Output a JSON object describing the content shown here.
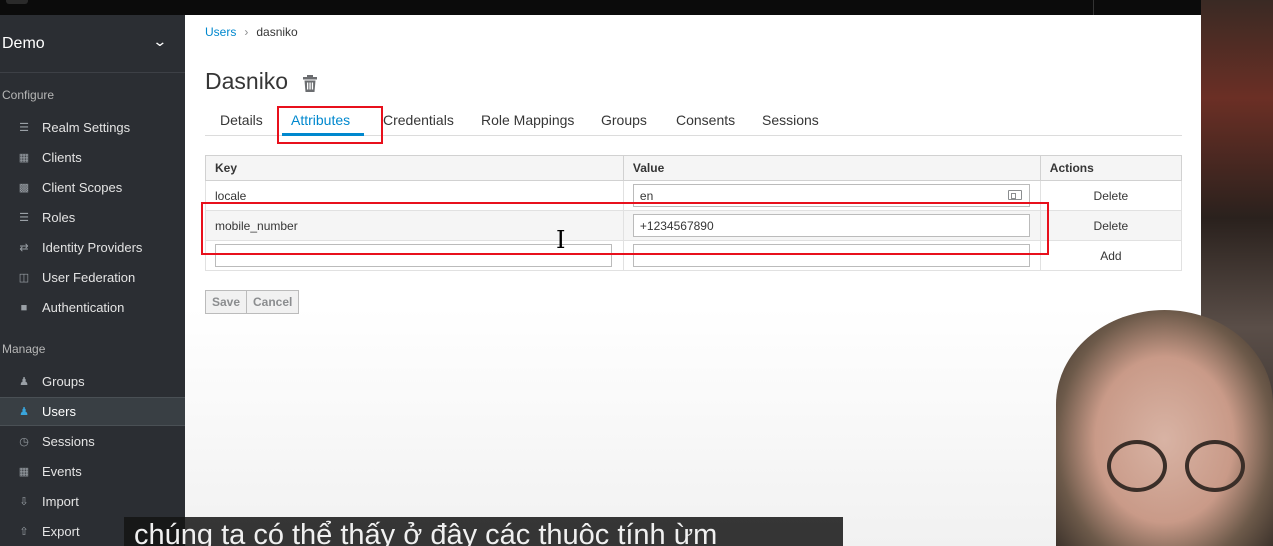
{
  "realm": {
    "name": "Demo"
  },
  "sidebar": {
    "configure_label": "Configure",
    "configure_items": [
      {
        "label": "Realm Settings",
        "icon": "sliders-icon"
      },
      {
        "label": "Clients",
        "icon": "cube-icon"
      },
      {
        "label": "Client Scopes",
        "icon": "cubes-icon"
      },
      {
        "label": "Roles",
        "icon": "list-icon"
      },
      {
        "label": "Identity Providers",
        "icon": "exchange-icon"
      },
      {
        "label": "User Federation",
        "icon": "database-icon"
      },
      {
        "label": "Authentication",
        "icon": "lock-icon"
      }
    ],
    "manage_label": "Manage",
    "manage_items": [
      {
        "label": "Groups",
        "icon": "users-icon"
      },
      {
        "label": "Users",
        "icon": "user-icon",
        "active": true
      },
      {
        "label": "Sessions",
        "icon": "clock-icon"
      },
      {
        "label": "Events",
        "icon": "calendar-icon"
      },
      {
        "label": "Import",
        "icon": "import-icon"
      },
      {
        "label": "Export",
        "icon": "export-icon"
      }
    ]
  },
  "breadcrumb": {
    "parent": "Users",
    "current": "dasniko"
  },
  "page": {
    "title": "Dasniko"
  },
  "tabs": [
    {
      "label": "Details"
    },
    {
      "label": "Attributes",
      "active": true
    },
    {
      "label": "Credentials"
    },
    {
      "label": "Role Mappings"
    },
    {
      "label": "Groups"
    },
    {
      "label": "Consents"
    },
    {
      "label": "Sessions"
    }
  ],
  "attributes": {
    "headers": {
      "key": "Key",
      "value": "Value",
      "actions": "Actions"
    },
    "rows": [
      {
        "key": "locale",
        "value": "en",
        "action": "Delete"
      },
      {
        "key": "mobile_number",
        "value": "+1234567890",
        "action": "Delete"
      }
    ],
    "new_row": {
      "key": "",
      "value": "",
      "action": "Add"
    }
  },
  "buttons": {
    "save": "Save",
    "cancel": "Cancel"
  },
  "subtitle": "chúng ta có thể thấy ở đây các thuộc tính ừm",
  "colors": {
    "accent": "#0088ce",
    "highlight": "#e8101c",
    "sidebar": "#2b2e33"
  }
}
